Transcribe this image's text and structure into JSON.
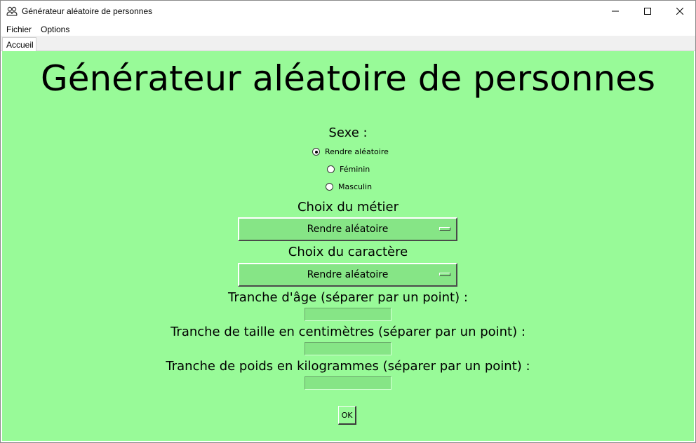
{
  "window": {
    "title": "Générateur aléatoire de personnes",
    "icon": "people-icon",
    "controls": {
      "minimize": "minimize-icon",
      "maximize": "maximize-icon",
      "close": "close-icon"
    }
  },
  "menu": {
    "items": [
      "Fichier",
      "Options"
    ]
  },
  "tabs": [
    {
      "label": "Accueil",
      "active": true
    }
  ],
  "main": {
    "title": "Générateur aléatoire de personnes",
    "sexe": {
      "label": "Sexe :",
      "options": [
        {
          "label": "Rendre aléatoire",
          "checked": true
        },
        {
          "label": "Féminin",
          "checked": false
        },
        {
          "label": "Masculin",
          "checked": false
        }
      ]
    },
    "metier": {
      "label": "Choix du métier",
      "selected": "Rendre aléatoire"
    },
    "caractere": {
      "label": "Choix du caractère",
      "selected": "Rendre aléatoire"
    },
    "age": {
      "label": "Tranche d'âge (séparer par un point) :",
      "value": ""
    },
    "taille": {
      "label": "Tranche de taille en centimètres (séparer par un point) :",
      "value": ""
    },
    "poids": {
      "label": "Tranche de poids en kilogrammes (séparer par un point) :",
      "value": ""
    },
    "ok_label": "OK"
  },
  "colors": {
    "background": "#98fa98",
    "widget": "#86e586"
  }
}
